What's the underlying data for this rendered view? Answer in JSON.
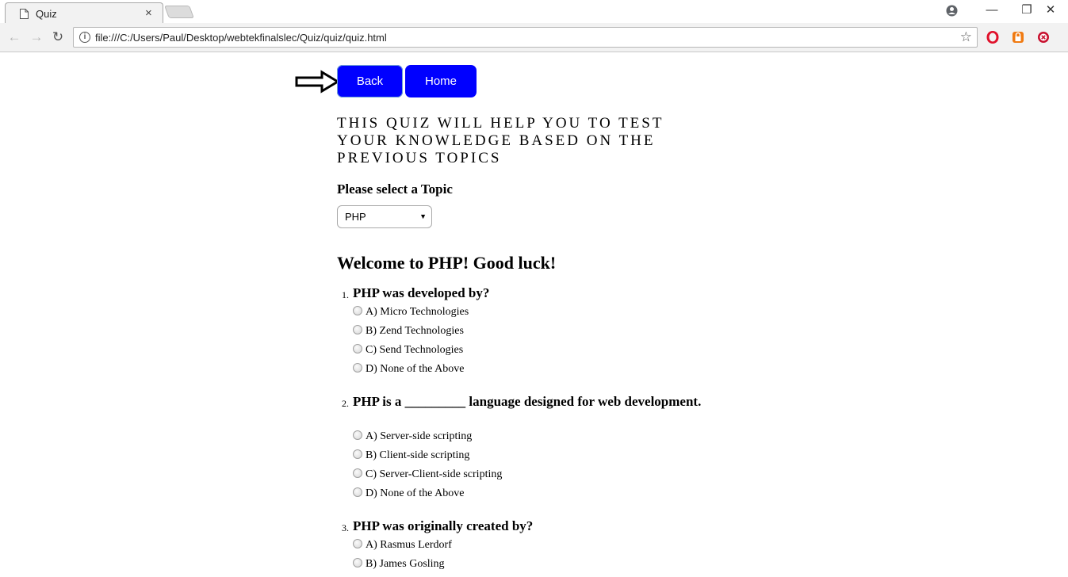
{
  "browser": {
    "tab_title": "Quiz",
    "tab_close": "×",
    "url": "file:///C:/Users/Paul/Desktop/webtekfinalslec/Quiz/quiz/quiz.html",
    "minimize": "—",
    "restore": "❐",
    "close": "✕"
  },
  "page": {
    "back_label": "Back",
    "home_label": "Home",
    "intro": "THIS QUIZ WILL HELP YOU TO TEST YOUR KNOWLEDGE BASED ON THE PREVIOUS TOPICS",
    "select_label": "Please select a Topic",
    "selected_topic": "PHP",
    "welcome": "Welcome to PHP! Good luck!"
  },
  "questions": [
    {
      "num": "1.",
      "text": "PHP was developed by?",
      "options": [
        "A) Micro Technologies",
        "B) Zend Technologies",
        "C) Send Technologies",
        "D) None of the Above"
      ]
    },
    {
      "num": "2.",
      "text": "PHP is a _________ language designed for web development.",
      "options": [
        "A) Server-side scripting",
        "B) Client-side scripting",
        "C) Server-Client-side scripting",
        "D) None of the Above"
      ]
    },
    {
      "num": "3.",
      "text": "PHP was originally created by?",
      "options": [
        "A) Rasmus Lerdorf",
        "B) James Gosling"
      ]
    }
  ]
}
